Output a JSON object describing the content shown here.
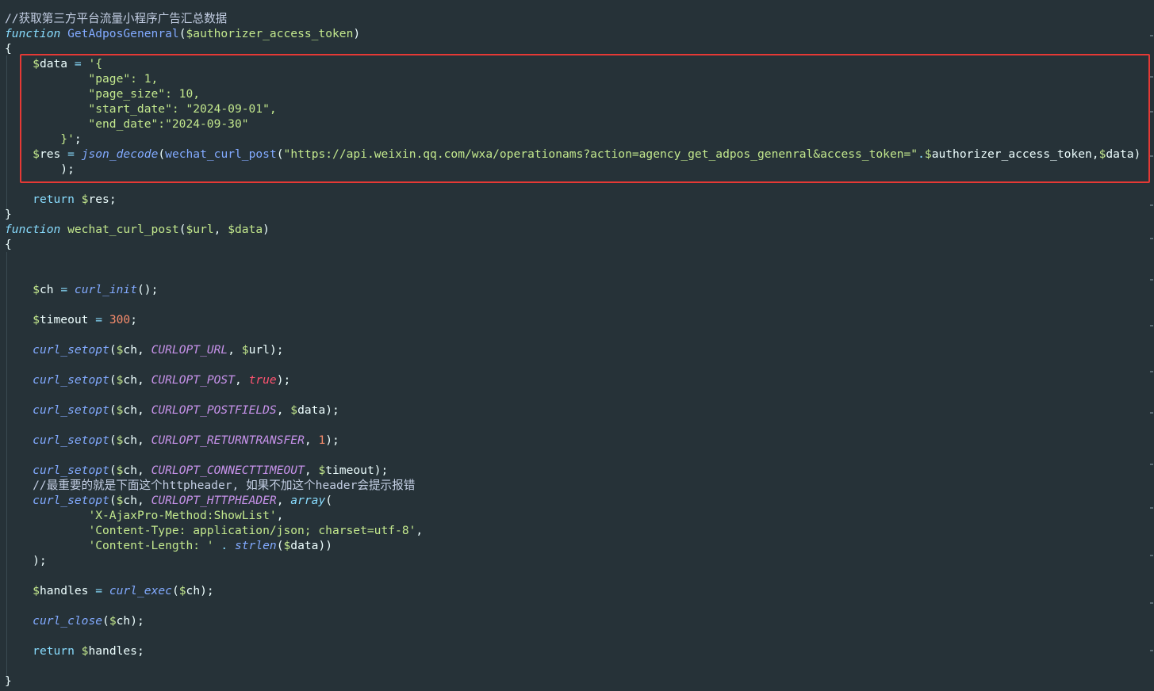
{
  "editor": {
    "lines": [
      [
        {
          "t": "//获取第三方平台流量小程序广告汇总数据",
          "c": "comment"
        }
      ],
      [
        {
          "t": "function",
          "c": "kw"
        },
        {
          "t": " ",
          "c": "punct"
        },
        {
          "t": "GetAdposGenenral",
          "c": "fn-name"
        },
        {
          "t": "(",
          "c": "punct"
        },
        {
          "t": "$",
          "c": "dollar"
        },
        {
          "t": "authorizer_access_token",
          "c": "var"
        },
        {
          "t": ")",
          "c": "punct"
        }
      ],
      [
        {
          "t": "{",
          "c": "punct"
        }
      ],
      [
        {
          "t": "    ",
          "c": "punct"
        },
        {
          "t": "$",
          "c": "dollar"
        },
        {
          "t": "data",
          "c": "var-w"
        },
        {
          "t": " ",
          "c": "punct"
        },
        {
          "t": "=",
          "c": "op"
        },
        {
          "t": " ",
          "c": "punct"
        },
        {
          "t": "'{",
          "c": "str"
        }
      ],
      [
        {
          "t": "            \"page\": 1,",
          "c": "str"
        }
      ],
      [
        {
          "t": "            \"page_size\": 10,",
          "c": "str"
        }
      ],
      [
        {
          "t": "            \"start_date\": \"2024-09-01\",",
          "c": "str"
        }
      ],
      [
        {
          "t": "            \"end_date\":\"2024-09-30\"",
          "c": "str"
        }
      ],
      [
        {
          "t": "        }'",
          "c": "str"
        },
        {
          "t": ";",
          "c": "punct"
        }
      ],
      [
        {
          "t": "    ",
          "c": "punct"
        },
        {
          "t": "$",
          "c": "dollar"
        },
        {
          "t": "res",
          "c": "var-w"
        },
        {
          "t": " ",
          "c": "punct"
        },
        {
          "t": "=",
          "c": "op"
        },
        {
          "t": " ",
          "c": "punct"
        },
        {
          "t": "json_decode",
          "c": "call"
        },
        {
          "t": "(",
          "c": "punct"
        },
        {
          "t": "wechat_curl_post",
          "c": "fn-name"
        },
        {
          "t": "(",
          "c": "punct"
        },
        {
          "t": "\"https://api.weixin.qq.com/wxa/operationams?action=agency_get_adpos_genenral&access_token=\"",
          "c": "str"
        },
        {
          "t": ".",
          "c": "op"
        },
        {
          "t": "$",
          "c": "dollar"
        },
        {
          "t": "authorizer_access_token",
          "c": "var-w"
        },
        {
          "t": ",",
          "c": "punct"
        },
        {
          "t": "$",
          "c": "dollar"
        },
        {
          "t": "data",
          "c": "var-w"
        },
        {
          "t": ")",
          "c": "punct"
        }
      ],
      [
        {
          "t": "        );",
          "c": "punct"
        }
      ],
      [
        {
          "t": "",
          "c": "punct"
        }
      ],
      [
        {
          "t": "    ",
          "c": "punct"
        },
        {
          "t": "return",
          "c": "op"
        },
        {
          "t": " ",
          "c": "punct"
        },
        {
          "t": "$",
          "c": "dollar"
        },
        {
          "t": "res",
          "c": "var-w"
        },
        {
          "t": ";",
          "c": "punct"
        }
      ],
      [
        {
          "t": "}",
          "c": "punct"
        }
      ],
      [
        {
          "t": "function",
          "c": "kw"
        },
        {
          "t": " ",
          "c": "punct"
        },
        {
          "t": "wechat_curl_post",
          "c": "var"
        },
        {
          "t": "(",
          "c": "punct"
        },
        {
          "t": "$",
          "c": "dollar"
        },
        {
          "t": "url",
          "c": "var"
        },
        {
          "t": ", ",
          "c": "punct"
        },
        {
          "t": "$",
          "c": "dollar"
        },
        {
          "t": "data",
          "c": "var"
        },
        {
          "t": ")",
          "c": "punct"
        }
      ],
      [
        {
          "t": "{",
          "c": "punct"
        }
      ],
      [
        {
          "t": "",
          "c": "punct"
        }
      ],
      [
        {
          "t": "",
          "c": "punct"
        }
      ],
      [
        {
          "t": "    ",
          "c": "punct"
        },
        {
          "t": "$",
          "c": "dollar"
        },
        {
          "t": "ch",
          "c": "var-w"
        },
        {
          "t": " ",
          "c": "punct"
        },
        {
          "t": "=",
          "c": "op"
        },
        {
          "t": " ",
          "c": "punct"
        },
        {
          "t": "curl_init",
          "c": "call"
        },
        {
          "t": "();",
          "c": "punct"
        }
      ],
      [
        {
          "t": "",
          "c": "punct"
        }
      ],
      [
        {
          "t": "    ",
          "c": "punct"
        },
        {
          "t": "$",
          "c": "dollar"
        },
        {
          "t": "timeout",
          "c": "var-w"
        },
        {
          "t": " ",
          "c": "punct"
        },
        {
          "t": "=",
          "c": "op"
        },
        {
          "t": " ",
          "c": "punct"
        },
        {
          "t": "300",
          "c": "num"
        },
        {
          "t": ";",
          "c": "punct"
        }
      ],
      [
        {
          "t": "",
          "c": "punct"
        }
      ],
      [
        {
          "t": "    ",
          "c": "punct"
        },
        {
          "t": "curl_setopt",
          "c": "call"
        },
        {
          "t": "(",
          "c": "punct"
        },
        {
          "t": "$",
          "c": "dollar"
        },
        {
          "t": "ch",
          "c": "var-w"
        },
        {
          "t": ", ",
          "c": "punct"
        },
        {
          "t": "CURLOPT_URL",
          "c": "const"
        },
        {
          "t": ", ",
          "c": "punct"
        },
        {
          "t": "$",
          "c": "dollar"
        },
        {
          "t": "url",
          "c": "var-w"
        },
        {
          "t": ");",
          "c": "punct"
        }
      ],
      [
        {
          "t": "",
          "c": "punct"
        }
      ],
      [
        {
          "t": "    ",
          "c": "punct"
        },
        {
          "t": "curl_setopt",
          "c": "call"
        },
        {
          "t": "(",
          "c": "punct"
        },
        {
          "t": "$",
          "c": "dollar"
        },
        {
          "t": "ch",
          "c": "var-w"
        },
        {
          "t": ", ",
          "c": "punct"
        },
        {
          "t": "CURLOPT_POST",
          "c": "const"
        },
        {
          "t": ", ",
          "c": "punct"
        },
        {
          "t": "true",
          "c": "bool"
        },
        {
          "t": ");",
          "c": "punct"
        }
      ],
      [
        {
          "t": "",
          "c": "punct"
        }
      ],
      [
        {
          "t": "    ",
          "c": "punct"
        },
        {
          "t": "curl_setopt",
          "c": "call"
        },
        {
          "t": "(",
          "c": "punct"
        },
        {
          "t": "$",
          "c": "dollar"
        },
        {
          "t": "ch",
          "c": "var-w"
        },
        {
          "t": ", ",
          "c": "punct"
        },
        {
          "t": "CURLOPT_POSTFIELDS",
          "c": "const"
        },
        {
          "t": ", ",
          "c": "punct"
        },
        {
          "t": "$",
          "c": "dollar"
        },
        {
          "t": "data",
          "c": "var-w"
        },
        {
          "t": ");",
          "c": "punct"
        }
      ],
      [
        {
          "t": "",
          "c": "punct"
        }
      ],
      [
        {
          "t": "    ",
          "c": "punct"
        },
        {
          "t": "curl_setopt",
          "c": "call"
        },
        {
          "t": "(",
          "c": "punct"
        },
        {
          "t": "$",
          "c": "dollar"
        },
        {
          "t": "ch",
          "c": "var-w"
        },
        {
          "t": ", ",
          "c": "punct"
        },
        {
          "t": "CURLOPT_RETURNTRANSFER",
          "c": "const"
        },
        {
          "t": ", ",
          "c": "punct"
        },
        {
          "t": "1",
          "c": "num"
        },
        {
          "t": ");",
          "c": "punct"
        }
      ],
      [
        {
          "t": "",
          "c": "punct"
        }
      ],
      [
        {
          "t": "    ",
          "c": "punct"
        },
        {
          "t": "curl_setopt",
          "c": "call"
        },
        {
          "t": "(",
          "c": "punct"
        },
        {
          "t": "$",
          "c": "dollar"
        },
        {
          "t": "ch",
          "c": "var-w"
        },
        {
          "t": ", ",
          "c": "punct"
        },
        {
          "t": "CURLOPT_CONNECTTIMEOUT",
          "c": "const"
        },
        {
          "t": ", ",
          "c": "punct"
        },
        {
          "t": "$",
          "c": "dollar"
        },
        {
          "t": "timeout",
          "c": "var-w"
        },
        {
          "t": ");",
          "c": "punct"
        }
      ],
      [
        {
          "t": "    //最重要的就是下面这个httpheader, 如果不加这个header会提示报错",
          "c": "comment"
        }
      ],
      [
        {
          "t": "    ",
          "c": "punct"
        },
        {
          "t": "curl_setopt",
          "c": "call"
        },
        {
          "t": "(",
          "c": "punct"
        },
        {
          "t": "$",
          "c": "dollar"
        },
        {
          "t": "ch",
          "c": "var-w"
        },
        {
          "t": ", ",
          "c": "punct"
        },
        {
          "t": "CURLOPT_HTTPHEADER",
          "c": "const"
        },
        {
          "t": ", ",
          "c": "punct"
        },
        {
          "t": "array",
          "c": "kw"
        },
        {
          "t": "(",
          "c": "punct"
        }
      ],
      [
        {
          "t": "            ",
          "c": "punct"
        },
        {
          "t": "'X-AjaxPro-Method:ShowList'",
          "c": "str"
        },
        {
          "t": ",",
          "c": "punct"
        }
      ],
      [
        {
          "t": "            ",
          "c": "punct"
        },
        {
          "t": "'Content-Type: application/json; charset=utf-8'",
          "c": "str"
        },
        {
          "t": ",",
          "c": "punct"
        }
      ],
      [
        {
          "t": "            ",
          "c": "punct"
        },
        {
          "t": "'Content-Length: '",
          "c": "str"
        },
        {
          "t": " ",
          "c": "punct"
        },
        {
          "t": ".",
          "c": "op"
        },
        {
          "t": " ",
          "c": "punct"
        },
        {
          "t": "strlen",
          "c": "call"
        },
        {
          "t": "(",
          "c": "punct"
        },
        {
          "t": "$",
          "c": "dollar"
        },
        {
          "t": "data",
          "c": "var-w"
        },
        {
          "t": "))",
          "c": "punct"
        }
      ],
      [
        {
          "t": "    );",
          "c": "punct"
        }
      ],
      [
        {
          "t": "",
          "c": "punct"
        }
      ],
      [
        {
          "t": "    ",
          "c": "punct"
        },
        {
          "t": "$",
          "c": "dollar"
        },
        {
          "t": "handles",
          "c": "var-w"
        },
        {
          "t": " ",
          "c": "punct"
        },
        {
          "t": "=",
          "c": "op"
        },
        {
          "t": " ",
          "c": "punct"
        },
        {
          "t": "curl_exec",
          "c": "call"
        },
        {
          "t": "(",
          "c": "punct"
        },
        {
          "t": "$",
          "c": "dollar"
        },
        {
          "t": "ch",
          "c": "var-w"
        },
        {
          "t": ");",
          "c": "punct"
        }
      ],
      [
        {
          "t": "",
          "c": "punct"
        }
      ],
      [
        {
          "t": "    ",
          "c": "punct"
        },
        {
          "t": "curl_close",
          "c": "call"
        },
        {
          "t": "(",
          "c": "punct"
        },
        {
          "t": "$",
          "c": "dollar"
        },
        {
          "t": "ch",
          "c": "var-w"
        },
        {
          "t": ");",
          "c": "punct"
        }
      ],
      [
        {
          "t": "",
          "c": "punct"
        }
      ],
      [
        {
          "t": "    ",
          "c": "punct"
        },
        {
          "t": "return",
          "c": "op"
        },
        {
          "t": " ",
          "c": "punct"
        },
        {
          "t": "$",
          "c": "dollar"
        },
        {
          "t": "handles",
          "c": "var-w"
        },
        {
          "t": ";",
          "c": "punct"
        }
      ],
      [
        {
          "t": "",
          "c": "punct"
        }
      ],
      [
        {
          "t": "}",
          "c": "punct"
        }
      ]
    ]
  },
  "colors": {
    "background": "#263238",
    "highlight_border": "#E53935"
  }
}
